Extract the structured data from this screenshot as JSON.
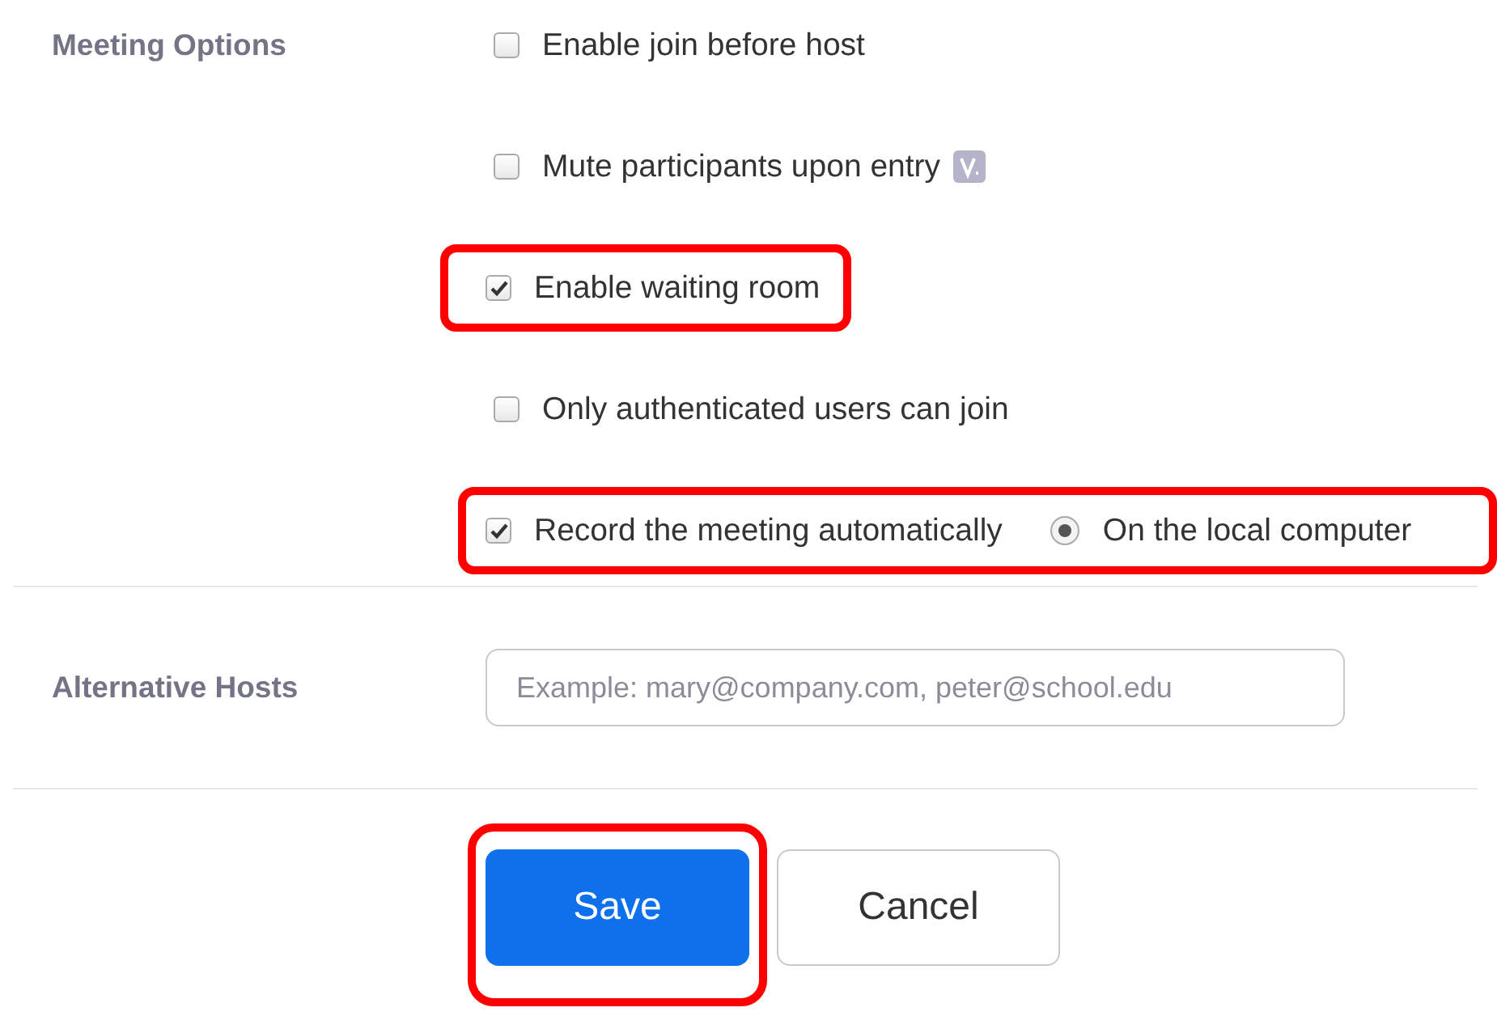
{
  "meeting_options": {
    "label": "Meeting Options",
    "options": [
      {
        "kind": "checkbox",
        "label": "Enable join before host",
        "checked": false,
        "highlighted": false,
        "badge": false
      },
      {
        "kind": "checkbox",
        "label": "Mute participants upon entry",
        "checked": false,
        "highlighted": false,
        "badge": true
      },
      {
        "kind": "checkbox",
        "label": "Enable waiting room",
        "checked": true,
        "highlighted": true,
        "badge": false
      },
      {
        "kind": "checkbox",
        "label": "Only authenticated users can join",
        "checked": false,
        "highlighted": false,
        "badge": false
      },
      {
        "kind": "checkbox",
        "label": "Record the meeting automatically",
        "checked": true,
        "highlighted": true,
        "badge": false,
        "radio": {
          "label": "On the local computer",
          "selected": true
        }
      }
    ]
  },
  "alternative_hosts": {
    "label": "Alternative Hosts",
    "placeholder": "Example: mary@company.com, peter@school.edu"
  },
  "buttons": [
    {
      "kind": "primary",
      "label": "Save",
      "highlighted": true
    },
    {
      "kind": "secondary",
      "label": "Cancel",
      "highlighted": false
    }
  ]
}
